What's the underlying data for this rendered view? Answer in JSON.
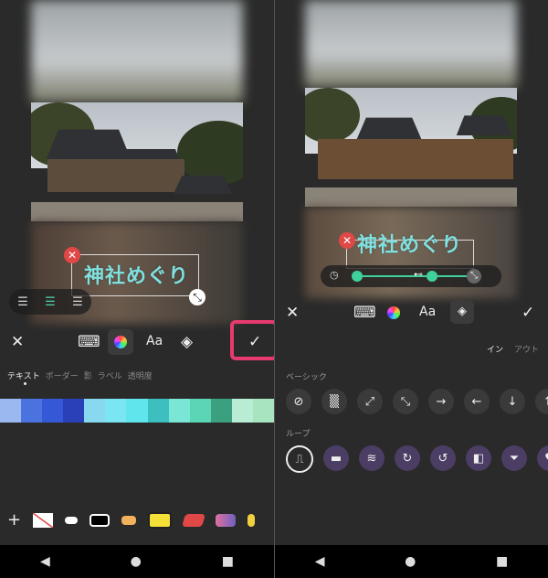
{
  "left": {
    "text_overlay": "神社めぐり",
    "align_icons": [
      "align-left",
      "align-center",
      "align-right"
    ],
    "toolbar": {
      "close": "✕",
      "keyboard": "⌨",
      "font_label": "Aa",
      "confirm": "✓"
    },
    "tabs": [
      "テキスト",
      "ボーダー",
      "影",
      "ラベル",
      "透明度"
    ],
    "active_tab": "テキスト",
    "swatches": [
      "#9bb8f0",
      "#4a73e0",
      "#3559d6",
      "#2a40b8",
      "#88d8f0",
      "#7ae6f2",
      "#5ee6ec",
      "#3dbfc0",
      "#7ae6d6",
      "#5ad6b4",
      "#3aa080",
      "#b8ecd4",
      "#a8e4c0"
    ],
    "add_label": "+",
    "style_colors": [
      "#ffffff",
      "#ffffff",
      "#f0b05c",
      "#f5e038",
      "#e04848",
      "#a070c8"
    ]
  },
  "right": {
    "text_overlay": "神社めぐり",
    "toolbar": {
      "close": "✕",
      "keyboard": "⌨",
      "font_label": "Aa",
      "confirm": "✓"
    },
    "toggle_in": "イン",
    "toggle_out": "アウト",
    "section_basic": "ベーシック",
    "section_loop": "ループ",
    "basic_icons": [
      "⊘",
      "▒",
      "⤢",
      "⤡",
      "→",
      "←",
      "↓",
      "↑"
    ],
    "loop_icons": [
      "⎍",
      "▬",
      "≋",
      "↻",
      "↺",
      "◧",
      "⏷",
      "♥"
    ]
  },
  "nav": {
    "back": "◀",
    "home": "●",
    "recents": "■"
  }
}
